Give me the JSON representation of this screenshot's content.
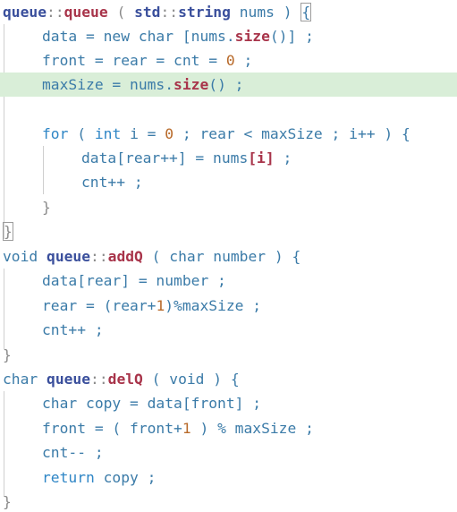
{
  "code": {
    "l1": {
      "cls": "queue",
      "sep": "::",
      "fn": "queue",
      "p1": " ( ",
      "cls2": "std",
      "sep2": "::",
      "cls3": "string",
      "rest": " nums ) ",
      "brace": "{"
    },
    "l2": {
      "a": "data = new char [nums.",
      "fn": "size",
      "b": "()] ;"
    },
    "l3": {
      "a": "front = rear = cnt = ",
      "num": "0",
      "b": " ;"
    },
    "l4": {
      "a": "maxSize = nums.",
      "fn": "size",
      "b": "() ;"
    },
    "l6": {
      "kw": "for",
      "a": " ( ",
      "kw2": "int",
      "b": " i = ",
      "num": "0",
      "c": " ; rear < maxSize ; i++ ) {"
    },
    "l7": {
      "a": "data[rear++] = nums",
      "fn": "[i]",
      "b": " ;"
    },
    "l8": {
      "a": "cnt++ ;"
    },
    "l9": {
      "a": "}"
    },
    "l10": {
      "a": "}"
    },
    "l11": {
      "a": "void ",
      "cls": "queue",
      "sep": "::",
      "fn": "addQ",
      "b": " ( char number ) {"
    },
    "l12": {
      "a": "data[rear] = number ;"
    },
    "l13": {
      "a": "rear = (rear+",
      "num": "1",
      "b": ")%maxSize ;"
    },
    "l14": {
      "a": "cnt++ ;"
    },
    "l15": {
      "a": "}"
    },
    "l16": {
      "a": "char ",
      "cls": "queue",
      "sep": "::",
      "fn": "delQ",
      "b": " ( void ) {"
    },
    "l17": {
      "a": "char copy = data[front] ;"
    },
    "l18": {
      "a": "front = ( front+",
      "num": "1",
      "b": " ) % maxSize ;"
    },
    "l19": {
      "a": "cnt-- ;"
    },
    "l20": {
      "kw": "return",
      "a": " copy ;"
    },
    "l21": {
      "a": "}"
    }
  },
  "colors": {
    "class": "#3a4f9c",
    "function": "#a8344a",
    "number": "#b86a2a",
    "keyword": "#2f86c6",
    "text": "#3b7ba8",
    "highlight": "#d9eed8"
  }
}
